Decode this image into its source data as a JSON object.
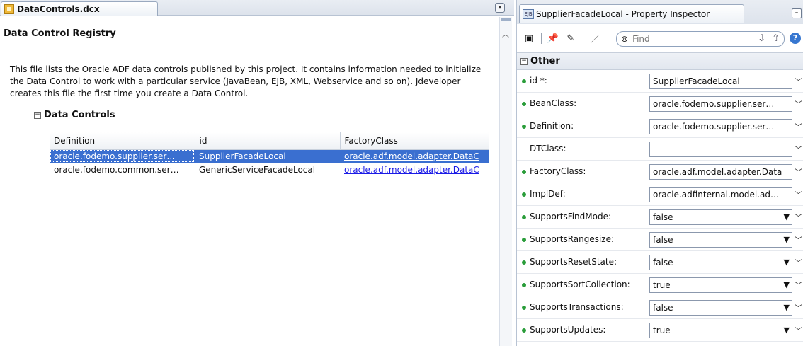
{
  "editor": {
    "tab_label": "DataControls.dcx",
    "tab_menu": "▾",
    "registry_title": "Data Control Registry",
    "description": "This file lists the Oracle ADF data controls published by this project. It contains information needed to initialize the Data Control to work with a particular service (JavaBean, EJB, XML, Webservice and so on). Jdeveloper creates this file the first time you create a Data Control.",
    "section_title": "Data Controls",
    "columns": [
      "Definition",
      "id",
      "FactoryClass"
    ],
    "rows": [
      {
        "definition": "oracle.fodemo.supplier.ser…",
        "id": "SupplierFacadeLocal",
        "factory": "oracle.adf.model.adapter.DataC"
      },
      {
        "definition": "oracle.fodemo.common.ser…",
        "id": "GenericServiceFacadeLocal",
        "factory": "oracle.adf.model.adapter.DataC"
      }
    ]
  },
  "inspector": {
    "tab_label": "SupplierFacadeLocal - Property Inspector",
    "find_placeholder": "Find",
    "group_title": "Other",
    "properties": [
      {
        "label": "id *:",
        "value": "SupplierFacadeLocal",
        "kind": "text",
        "bullet": true
      },
      {
        "label": "BeanClass:",
        "value": "oracle.fodemo.supplier.ser…",
        "kind": "text",
        "bullet": true
      },
      {
        "label": "Definition:",
        "value": "oracle.fodemo.supplier.ser…",
        "kind": "text",
        "bullet": true
      },
      {
        "label": "DTClass:",
        "value": "",
        "kind": "text",
        "bullet": false
      },
      {
        "label": "FactoryClass:",
        "value": "oracle.adf.model.adapter.Data",
        "kind": "text",
        "bullet": true
      },
      {
        "label": "ImplDef:",
        "value": "oracle.adfinternal.model.ad…",
        "kind": "text",
        "bullet": true
      },
      {
        "label": "SupportsFindMode:",
        "value": "false",
        "kind": "select",
        "bullet": true
      },
      {
        "label": "SupportsRangesize:",
        "value": "false",
        "kind": "select",
        "bullet": true
      },
      {
        "label": "SupportsResetState:",
        "value": "false",
        "kind": "select",
        "bullet": true
      },
      {
        "label": "SupportsSortCollection:",
        "value": "true",
        "kind": "select",
        "bullet": true
      },
      {
        "label": "SupportsTransactions:",
        "value": "false",
        "kind": "select",
        "bullet": true
      },
      {
        "label": "SupportsUpdates:",
        "value": "true",
        "kind": "select",
        "bullet": true
      }
    ]
  },
  "colors": {
    "selection": "#3a6fd0",
    "link": "#1a1ae6",
    "bullet": "#2a9d3a"
  }
}
